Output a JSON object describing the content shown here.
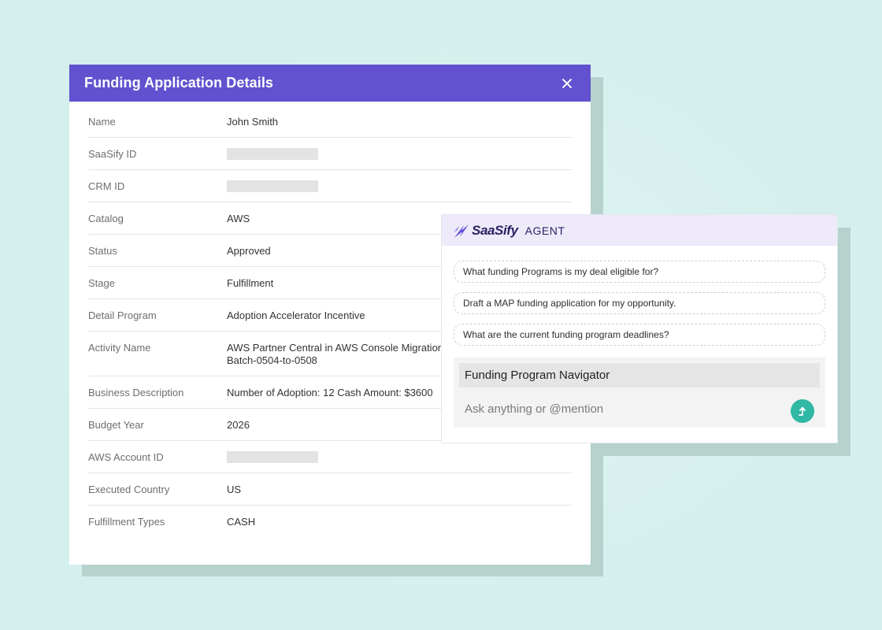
{
  "application": {
    "title": "Funding Application Details",
    "rows": [
      {
        "label": "Name",
        "value": "John Smith"
      },
      {
        "label": "SaaSify ID",
        "value": ""
      },
      {
        "label": "CRM ID",
        "value": ""
      },
      {
        "label": "Catalog",
        "value": "AWS"
      },
      {
        "label": "Status",
        "value": "Approved"
      },
      {
        "label": "Stage",
        "value": "Fulfillment"
      },
      {
        "label": "Detail Program",
        "value": "Adoption Accelerator Incentive"
      },
      {
        "label": "Activity Name",
        "value": "AWS Partner Central in AWS Console Migration\nBatch-0504-to-0508"
      },
      {
        "label": "Business Description",
        "value": "Number of Adoption: 12 Cash Amount: $3600"
      },
      {
        "label": "Budget Year",
        "value": "2026"
      },
      {
        "label": "AWS Account ID",
        "value": ""
      },
      {
        "label": "Executed Country",
        "value": "US"
      },
      {
        "label": "Fulfillment Types",
        "value": "CASH"
      }
    ]
  },
  "agent": {
    "brand": "SaaSify",
    "label": "AGENT",
    "suggestions": [
      "What funding Programs is my deal eligible for?",
      "Draft a MAP funding application for my opportunity.",
      "What are the current funding program deadlines?"
    ],
    "composer": {
      "title": "Funding Program Navigator",
      "placeholder": "Ask anything or @mention"
    }
  },
  "colors": {
    "header": "#6252cf",
    "agent_header": "#eeeaf9",
    "send": "#2fb8a3",
    "background": "#d4efed"
  },
  "icons": {
    "close": "close-icon",
    "brand": "saasify-logo-icon",
    "send": "send-arrow-icon"
  }
}
